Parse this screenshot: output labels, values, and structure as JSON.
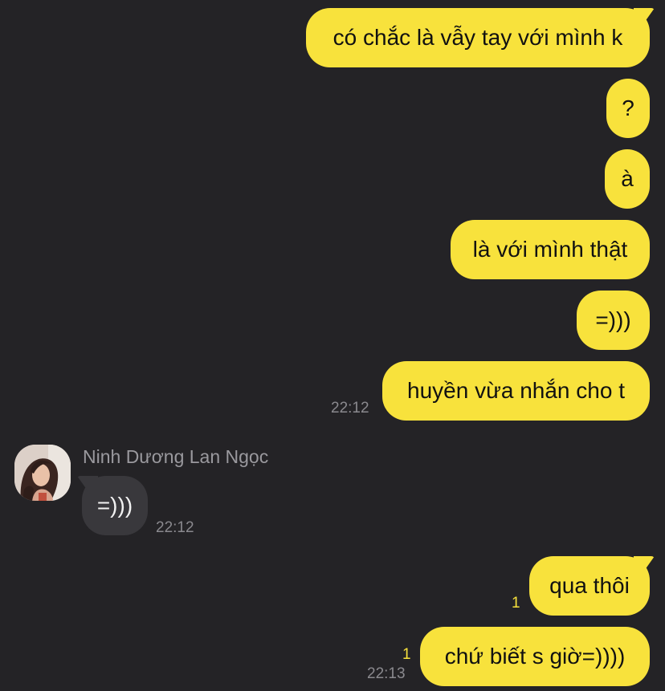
{
  "conversation": {
    "outgoing": [
      {
        "text": "có chắc là vẫy tay với mình k"
      },
      {
        "text": "?"
      },
      {
        "text": "à"
      },
      {
        "text": "là với mình thật"
      },
      {
        "text": "=)))"
      },
      {
        "text": "huyền vừa nhắn cho t",
        "time": "22:12"
      }
    ],
    "incoming": {
      "sender": "Ninh Dương Lan Ngọc",
      "text": "=)))",
      "time": "22:12"
    },
    "outgoing_late": [
      {
        "text": "qua thôi",
        "unread": "1"
      },
      {
        "text": "chứ biết s giờ=))))",
        "unread": "1",
        "time": "22:13"
      }
    ]
  },
  "colors": {
    "background": "#242326",
    "outgoing_bubble": "#f8e23c",
    "incoming_bubble": "#39383c",
    "unread_count": "#f8e23c",
    "timestamp": "#8a898e"
  }
}
